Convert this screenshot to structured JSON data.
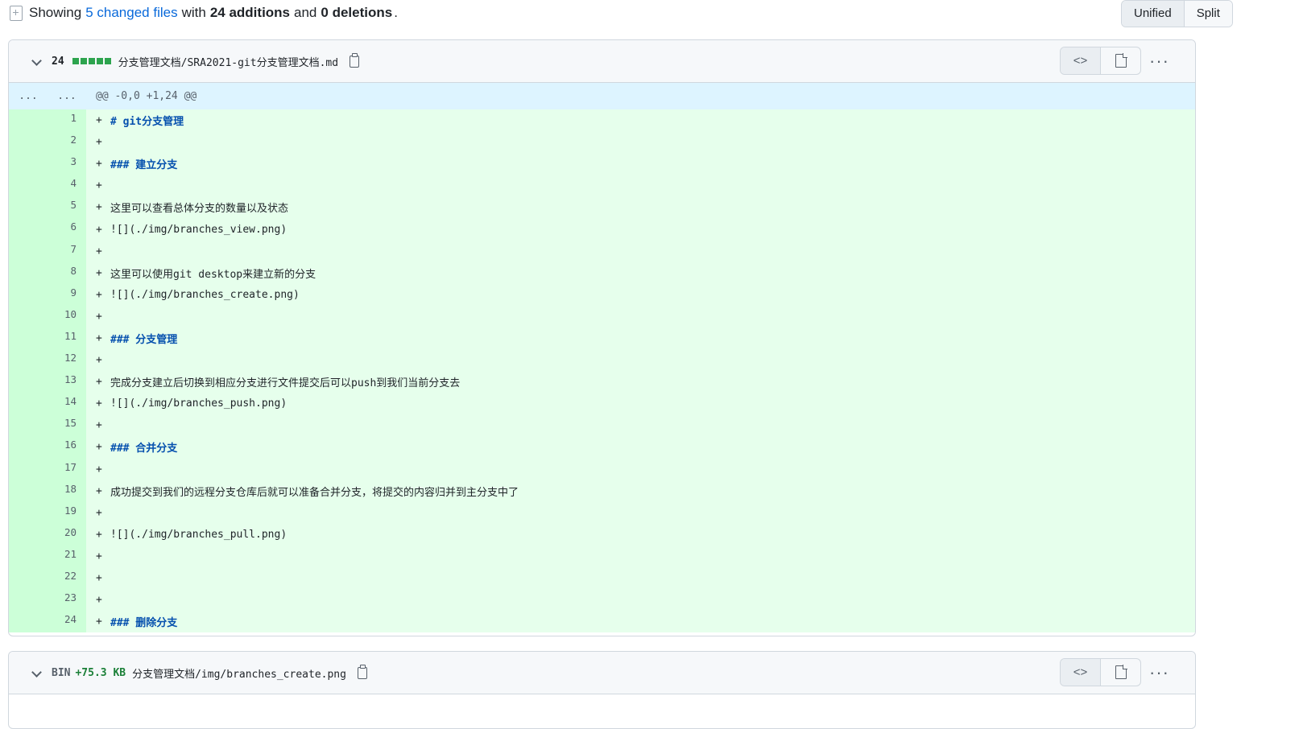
{
  "summary": {
    "prefix": "Showing",
    "changed_files": "5 changed files",
    "with": "with",
    "additions": "24 additions",
    "and": "and",
    "deletions": "0 deletions",
    "suffix": "."
  },
  "view_toggle": {
    "unified": "Unified",
    "split": "Split",
    "active": "Unified"
  },
  "files": [
    {
      "count": "24",
      "name": "分支管理文档/SRA2021-git分支管理文档.md",
      "hunk": {
        "old": "...",
        "new": "...",
        "header": "@@ -0,0 +1,24 @@"
      },
      "lines": [
        {
          "n": "1",
          "text": "# git分支管理",
          "heading": true
        },
        {
          "n": "2",
          "text": ""
        },
        {
          "n": "3",
          "text": "### 建立分支",
          "heading": true
        },
        {
          "n": "4",
          "text": ""
        },
        {
          "n": "5",
          "text": "这里可以查看总体分支的数量以及状态"
        },
        {
          "n": "6",
          "text": "![](./img/branches_view.png)"
        },
        {
          "n": "7",
          "text": ""
        },
        {
          "n": "8",
          "text": "这里可以使用git desktop来建立新的分支"
        },
        {
          "n": "9",
          "text": "![](./img/branches_create.png)"
        },
        {
          "n": "10",
          "text": ""
        },
        {
          "n": "11",
          "text": "### 分支管理",
          "heading": true
        },
        {
          "n": "12",
          "text": ""
        },
        {
          "n": "13",
          "text": "完成分支建立后切换到相应分支进行文件提交后可以push到我们当前分支去"
        },
        {
          "n": "14",
          "text": "![](./img/branches_push.png)"
        },
        {
          "n": "15",
          "text": ""
        },
        {
          "n": "16",
          "text": "### 合并分支",
          "heading": true
        },
        {
          "n": "17",
          "text": ""
        },
        {
          "n": "18",
          "text": "成功提交到我们的远程分支仓库后就可以准备合并分支，将提交的内容归并到主分支中了"
        },
        {
          "n": "19",
          "text": ""
        },
        {
          "n": "20",
          "text": "![](./img/branches_pull.png)"
        },
        {
          "n": "21",
          "text": ""
        },
        {
          "n": "22",
          "text": ""
        },
        {
          "n": "23",
          "text": ""
        },
        {
          "n": "24",
          "text": "### 删除分支",
          "heading": true
        }
      ]
    },
    {
      "bin": "BIN",
      "size": "+75.3 KB",
      "name": "分支管理文档/img/branches_create.png"
    }
  ],
  "icons": {
    "collapse": "chevron-down-icon",
    "copy": "copy-icon",
    "code": "code-icon",
    "file": "file-icon",
    "more": "kebab-horizontal-icon"
  },
  "colors": {
    "added_line": "#e6ffec",
    "added_gutter": "#ccffd8",
    "hunk": "#ddf4ff",
    "link": "#0969da",
    "diffstat_green": "#2da44e"
  }
}
